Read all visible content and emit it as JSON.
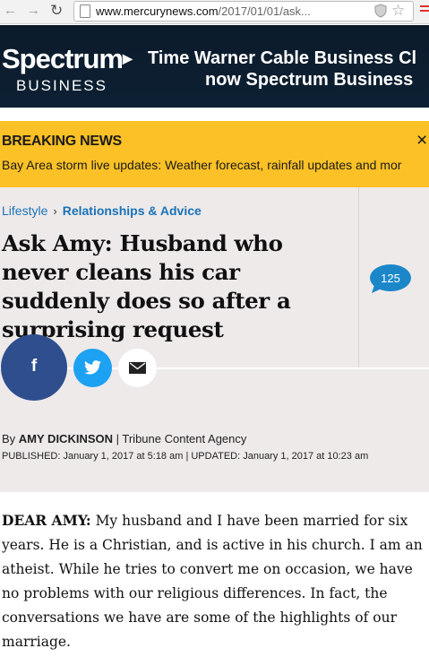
{
  "browser": {
    "url_host": "www.mercurynews.com",
    "url_path": "/2017/01/01/ask..."
  },
  "ad": {
    "logo_brand": "Spectrum",
    "logo_sub": "BUSINESS",
    "line1": "Time Warner Cable Business Cl",
    "line2": "now Spectrum Business"
  },
  "breaking": {
    "title": "BREAKING NEWS",
    "close": "×",
    "text": "Bay Area storm live updates: Weather forecast, rainfall updates and mor"
  },
  "breadcrumb": {
    "section": "Lifestyle",
    "separator": "›",
    "subsection": "Relationships & Advice"
  },
  "article": {
    "headline": "Ask Amy: Husband who never cleans his car suddenly does so after a surprising request",
    "comment_count": "125",
    "by_prefix": "By",
    "author": "AMY DICKINSON",
    "agency": "| Tribune Content Agency",
    "dates": "PUBLISHED: January 1, 2017 at 5:18 am | UPDATED: January 1, 2017 at 10:23 am",
    "lead": "DEAR AMY:",
    "body": "My husband and I have been married for six years. He is a Christian, and is active in his church. I am an atheist. While he tries to convert me on occasion, we have no problems with our religious differences. In fact, the conversations we have are some of the highlights of our marriage."
  },
  "share": {
    "facebook_glyph": "f",
    "twitter_icon": "twitter-icon",
    "email_icon": "mail-icon"
  },
  "colors": {
    "breaking_bg": "#fcc126",
    "link_blue": "#1a73b8",
    "facebook": "#2e4e8e",
    "twitter": "#1da1f2",
    "comment_bubble": "#1b87c9"
  }
}
